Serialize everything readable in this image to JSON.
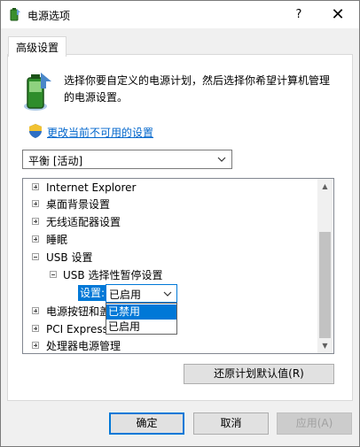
{
  "window": {
    "title": "电源选项",
    "help_glyph": "?",
    "close_glyph": "✕"
  },
  "tab": {
    "label": "高级设置"
  },
  "description": "选择你要自定义的电源计划，然后选择你希望计算机管理的电源设置。",
  "change_link": "更改当前不可用的设置",
  "plan_select": {
    "value": "平衡 [活动]"
  },
  "tree": {
    "items": [
      {
        "label": "Internet Explorer",
        "expander": "+"
      },
      {
        "label": "桌面背景设置",
        "expander": "+"
      },
      {
        "label": "无线适配器设置",
        "expander": "+"
      },
      {
        "label": "睡眠",
        "expander": "+"
      },
      {
        "label": "USB 设置",
        "expander": "-"
      },
      {
        "label": "USB 选择性暂停设置",
        "expander": "-"
      },
      {
        "label": "电源按钮和盖",
        "expander": "+"
      },
      {
        "label": "PCI Express",
        "expander": "+"
      },
      {
        "label": "处理器电源管理",
        "expander": "+"
      }
    ],
    "setting_label": "设置:",
    "setting_value": "已启用",
    "dropdown_options": [
      "已禁用",
      "已启用"
    ]
  },
  "restore_button": "还原计划默认值(R)",
  "buttons": {
    "ok": "确定",
    "cancel": "取消",
    "apply": "应用(A)"
  },
  "colors": {
    "accent": "#0078d7",
    "link": "#0066cc"
  }
}
